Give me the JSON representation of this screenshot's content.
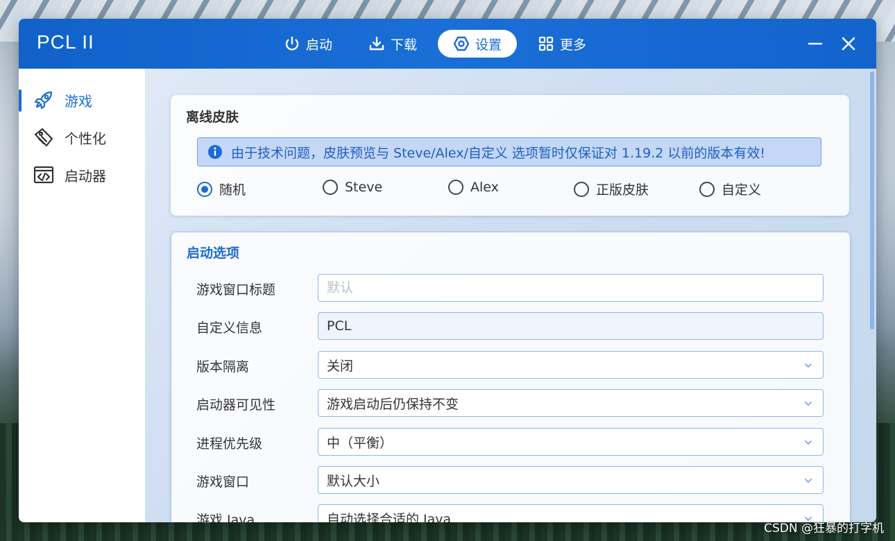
{
  "app": {
    "title": "PCL II"
  },
  "nav": [
    {
      "label": "启动",
      "icon": "power-icon",
      "active": false
    },
    {
      "label": "下载",
      "icon": "download-icon",
      "active": false
    },
    {
      "label": "设置",
      "icon": "settings-hexagon-icon",
      "active": true
    },
    {
      "label": "更多",
      "icon": "grid-icon",
      "active": false
    }
  ],
  "sidebar": {
    "items": [
      {
        "label": "游戏",
        "icon": "rocket-icon",
        "active": true
      },
      {
        "label": "个性化",
        "icon": "paint-tag-icon",
        "active": false
      },
      {
        "label": "启动器",
        "icon": "code-window-icon",
        "active": false
      }
    ]
  },
  "offline_skin": {
    "title": "离线皮肤",
    "notice": "由于技术问题，皮肤预览与 Steve/Alex/自定义 选项暂时仅保证对 1.19.2 以前的版本有效!",
    "options": [
      "随机",
      "Steve",
      "Alex",
      "正版皮肤",
      "自定义"
    ],
    "selected": "随机"
  },
  "launch_options": {
    "title": "启动选项",
    "rows": {
      "window_title": {
        "label": "游戏窗口标题",
        "value": "",
        "placeholder": "默认"
      },
      "custom_info": {
        "label": "自定义信息",
        "value": "PCL"
      },
      "isolation": {
        "label": "版本隔离",
        "value": "关闭"
      },
      "visibility": {
        "label": "启动器可见性",
        "value": "游戏启动后仍保持不变"
      },
      "priority": {
        "label": "进程优先级",
        "value": "中（平衡）"
      },
      "window": {
        "label": "游戏窗口",
        "value": "默认大小"
      },
      "java": {
        "label": "游戏 Java",
        "value": "自动选择合适的 Java"
      }
    }
  },
  "watermark": "CSDN @狂暴的打字机",
  "colors": {
    "accent": "#1c6bd3",
    "titlebar": "#1a6fd6"
  }
}
